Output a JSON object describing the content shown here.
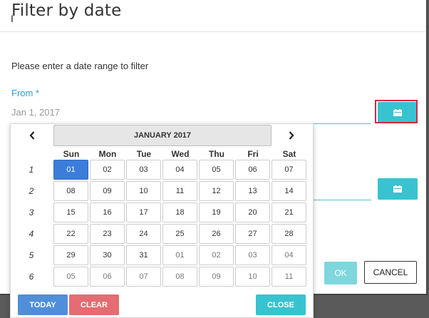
{
  "dialog": {
    "title": "Filter by date",
    "instructions": "Please enter a date range to filter",
    "from_label": "From *",
    "from_value": "Jan 1, 2017",
    "ok_label": "OK",
    "cancel_label": "CANCEL"
  },
  "datepicker": {
    "month_label": "JANUARY 2017",
    "prev_icon": "chevron-left-icon",
    "next_icon": "chevron-right-icon",
    "days_of_week": [
      "Sun",
      "Mon",
      "Tue",
      "Wed",
      "Thu",
      "Fri",
      "Sat"
    ],
    "weeks": [
      {
        "week": "1",
        "days": [
          {
            "d": "01",
            "cur": true,
            "sel": true
          },
          {
            "d": "02",
            "cur": true
          },
          {
            "d": "03",
            "cur": true
          },
          {
            "d": "04",
            "cur": true
          },
          {
            "d": "05",
            "cur": true
          },
          {
            "d": "06",
            "cur": true
          },
          {
            "d": "07",
            "cur": true
          }
        ]
      },
      {
        "week": "2",
        "days": [
          {
            "d": "08",
            "cur": true
          },
          {
            "d": "09",
            "cur": true
          },
          {
            "d": "10",
            "cur": true
          },
          {
            "d": "11",
            "cur": true
          },
          {
            "d": "12",
            "cur": true
          },
          {
            "d": "13",
            "cur": true
          },
          {
            "d": "14",
            "cur": true
          }
        ]
      },
      {
        "week": "3",
        "days": [
          {
            "d": "15",
            "cur": true
          },
          {
            "d": "16",
            "cur": true
          },
          {
            "d": "17",
            "cur": true
          },
          {
            "d": "18",
            "cur": true
          },
          {
            "d": "19",
            "cur": true
          },
          {
            "d": "20",
            "cur": true
          },
          {
            "d": "21",
            "cur": true
          }
        ]
      },
      {
        "week": "4",
        "days": [
          {
            "d": "22",
            "cur": true
          },
          {
            "d": "23",
            "cur": true
          },
          {
            "d": "24",
            "cur": true
          },
          {
            "d": "25",
            "cur": true
          },
          {
            "d": "26",
            "cur": true
          },
          {
            "d": "27",
            "cur": true
          },
          {
            "d": "28",
            "cur": true
          }
        ]
      },
      {
        "week": "5",
        "days": [
          {
            "d": "29",
            "cur": true
          },
          {
            "d": "30",
            "cur": true
          },
          {
            "d": "31",
            "cur": true
          },
          {
            "d": "01",
            "cur": false
          },
          {
            "d": "02",
            "cur": false
          },
          {
            "d": "03",
            "cur": false
          },
          {
            "d": "04",
            "cur": false
          }
        ]
      },
      {
        "week": "6",
        "days": [
          {
            "d": "05",
            "cur": false
          },
          {
            "d": "06",
            "cur": false
          },
          {
            "d": "07",
            "cur": false
          },
          {
            "d": "08",
            "cur": false
          },
          {
            "d": "09",
            "cur": false
          },
          {
            "d": "10",
            "cur": false
          },
          {
            "d": "11",
            "cur": false
          }
        ]
      }
    ],
    "today_label": "TODAY",
    "clear_label": "CLEAR",
    "close_label": "CLOSE"
  },
  "colors": {
    "accent": "#38c3d0",
    "label": "#2a9fd6",
    "selected_day": "#3b7dd8",
    "today_button": "#4f8ed8",
    "clear_button": "#e46c72",
    "highlight": "#d9263a"
  },
  "icons": {
    "calendar": "calendar-icon"
  }
}
